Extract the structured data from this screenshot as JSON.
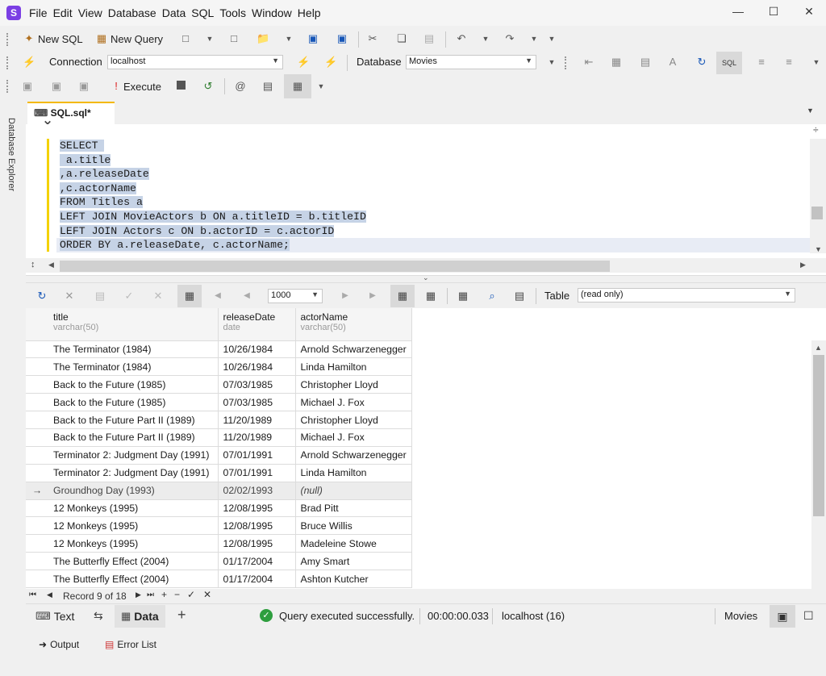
{
  "menu": [
    "File",
    "Edit",
    "View",
    "Database",
    "Data",
    "SQL",
    "Tools",
    "Window",
    "Help"
  ],
  "toolbar1": {
    "new_sql": "New SQL",
    "new_query": "New Query"
  },
  "toolbar2": {
    "connection_label": "Connection",
    "connection_value": "localhost",
    "database_label": "Database",
    "database_value": "Movies"
  },
  "toolbar3": {
    "execute": "Execute"
  },
  "side": {
    "database_explorer": "Database Explorer"
  },
  "tab": {
    "title": "SQL.sql*"
  },
  "code": [
    "SELECT ",
    " a.title",
    ",a.releaseDate",
    ",c.actorName",
    "FROM Titles a",
    "LEFT JOIN MovieActors b ON a.titleID = b.titleID",
    "LEFT JOIN Actors c ON b.actorID = c.actorID",
    "ORDER BY a.releaseDate, c.actorName;"
  ],
  "gridtoolbar": {
    "page_size": "1000",
    "view_label": "Table",
    "view_mode": "(read only)"
  },
  "columns": [
    {
      "name": "title",
      "type": "varchar(50)"
    },
    {
      "name": "releaseDate",
      "type": "date"
    },
    {
      "name": "actorName",
      "type": "varchar(50)"
    }
  ],
  "rows": [
    [
      "The Terminator (1984)",
      "10/26/1984",
      "Arnold Schwarzenegger"
    ],
    [
      "The Terminator (1984)",
      "10/26/1984",
      "Linda Hamilton"
    ],
    [
      "Back to the Future (1985)",
      "07/03/1985",
      "Christopher Lloyd"
    ],
    [
      "Back to the Future (1985)",
      "07/03/1985",
      "Michael J. Fox"
    ],
    [
      "Back to the Future Part II (1989)",
      "11/20/1989",
      "Christopher Lloyd"
    ],
    [
      "Back to the Future Part II (1989)",
      "11/20/1989",
      "Michael J. Fox"
    ],
    [
      "Terminator 2: Judgment Day (1991)",
      "07/01/1991",
      "Arnold Schwarzenegger"
    ],
    [
      "Terminator 2: Judgment Day (1991)",
      "07/01/1991",
      "Linda Hamilton"
    ],
    [
      "Groundhog Day (1993)",
      "02/02/1993",
      "(null)"
    ],
    [
      "12 Monkeys (1995)",
      "12/08/1995",
      "Brad Pitt"
    ],
    [
      "12 Monkeys (1995)",
      "12/08/1995",
      "Bruce Willis"
    ],
    [
      "12 Monkeys (1995)",
      "12/08/1995",
      "Madeleine Stowe"
    ],
    [
      "The Butterfly Effect (2004)",
      "01/17/2004",
      "Amy Smart"
    ],
    [
      "The Butterfly Effect (2004)",
      "01/17/2004",
      "Ashton Kutcher"
    ]
  ],
  "current_row_index": 8,
  "nav": {
    "record": "Record 9 of 18"
  },
  "status": {
    "text_tab": "Text",
    "data_tab": "Data",
    "message": "Query executed successfully.",
    "elapsed": "00:00:00.033",
    "server": "localhost (16)",
    "database": "Movies"
  },
  "bottom": {
    "output": "Output",
    "error_list": "Error List"
  },
  "colors": {
    "accent": "#7b3fe4",
    "tab_marker": "#f3b800",
    "selection": "#c6d3e6",
    "success": "#2e9e3e",
    "row_arrow": "#1e88e5"
  }
}
